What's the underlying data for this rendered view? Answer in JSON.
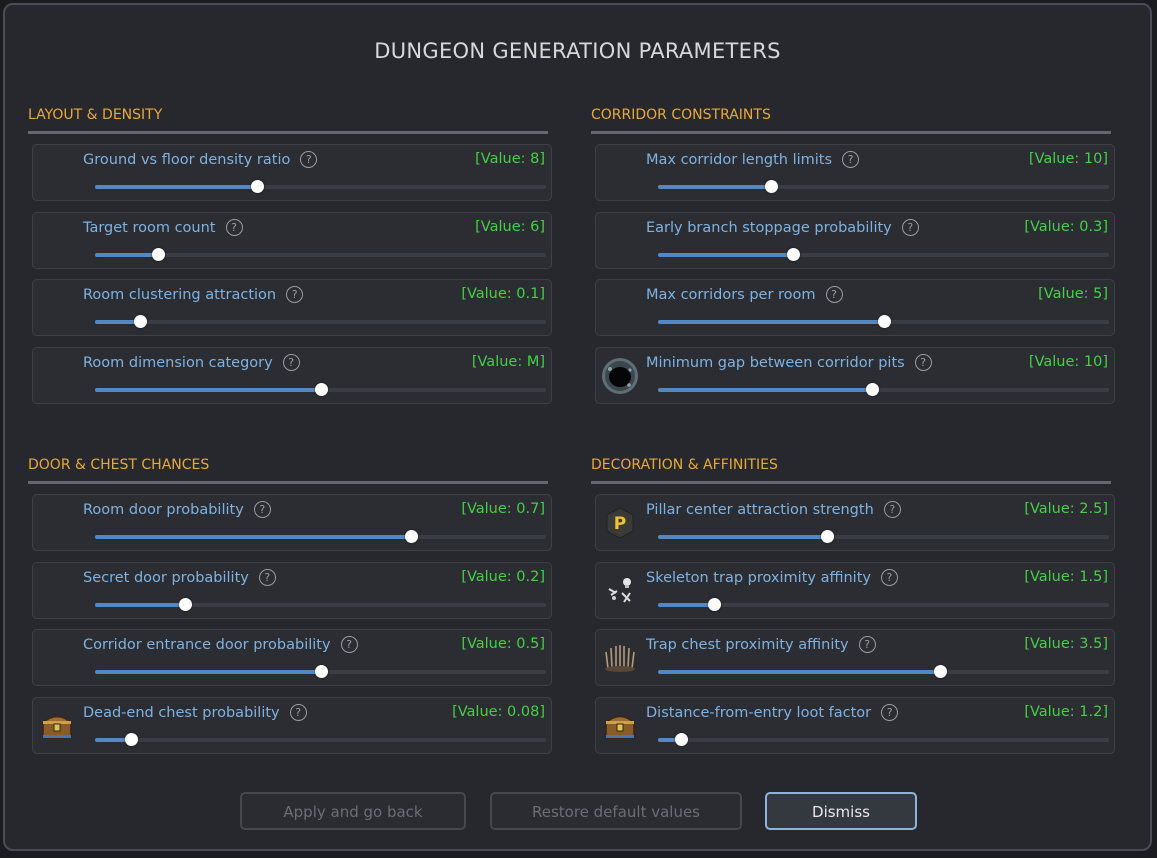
{
  "dialog": {
    "title": "DUNGEON GENERATION PARAMETERS"
  },
  "sections": [
    {
      "header": "LAYOUT & DENSITY",
      "rows": [
        {
          "label": "Ground vs floor density ratio",
          "value": "[Value: 8]",
          "fraction": 0.36,
          "icon": ""
        },
        {
          "label": "Target room count",
          "value": "[Value: 6]",
          "fraction": 0.14,
          "icon": ""
        },
        {
          "label": "Room clustering attraction",
          "value": "[Value: 0.1]",
          "fraction": 0.1,
          "icon": ""
        },
        {
          "label": "Room dimension category",
          "value": "[Value: M]",
          "fraction": 0.5,
          "icon": ""
        }
      ]
    },
    {
      "header": "CORRIDOR CONSTRAINTS",
      "rows": [
        {
          "label": "Max corridor length limits",
          "value": "[Value: 10]",
          "fraction": 0.25,
          "icon": ""
        },
        {
          "label": "Early branch stoppage probability",
          "value": "[Value: 0.3]",
          "fraction": 0.3,
          "icon": ""
        },
        {
          "label": "Max corridors per room",
          "value": "[Value: 5]",
          "fraction": 0.5,
          "icon": ""
        },
        {
          "label": "Minimum gap between corridor pits",
          "value": "[Value: 10]",
          "fraction": 0.475,
          "icon": "pit-icon"
        }
      ]
    },
    {
      "header": "DOOR & CHEST CHANCES",
      "rows": [
        {
          "label": "Room door probability",
          "value": "[Value: 0.7]",
          "fraction": 0.7,
          "icon": ""
        },
        {
          "label": "Secret door probability",
          "value": "[Value: 0.2]",
          "fraction": 0.2,
          "icon": ""
        },
        {
          "label": "Corridor entrance door probability",
          "value": "[Value: 0.5]",
          "fraction": 0.5,
          "icon": ""
        },
        {
          "label": "Dead-end chest probability",
          "value": "[Value: 0.08]",
          "fraction": 0.08,
          "icon": "chest-icon"
        }
      ]
    },
    {
      "header": "DECORATION & AFFINITIES",
      "rows": [
        {
          "label": "Pillar center attraction strength",
          "value": "[Value: 2.5]",
          "fraction": 0.375,
          "icon": "pillar-icon"
        },
        {
          "label": "Skeleton trap proximity affinity",
          "value": "[Value: 1.5]",
          "fraction": 0.125,
          "icon": "skeleton-icon"
        },
        {
          "label": "Trap chest proximity affinity",
          "value": "[Value: 3.5]",
          "fraction": 0.625,
          "icon": "spike-trap-icon"
        },
        {
          "label": "Distance-from-entry loot factor",
          "value": "[Value: 1.2]",
          "fraction": 0.05,
          "icon": "chest-icon"
        }
      ]
    }
  ],
  "help_glyph": "?",
  "pillar_letter": "P",
  "buttons": {
    "apply": "Apply and go back",
    "restore": "Restore default values",
    "dismiss": "Dismiss"
  },
  "colors": {
    "section_header": "#e8a93a",
    "label": "#7fb2e0",
    "value": "#45d045",
    "slider_fill": "#5289c5"
  }
}
